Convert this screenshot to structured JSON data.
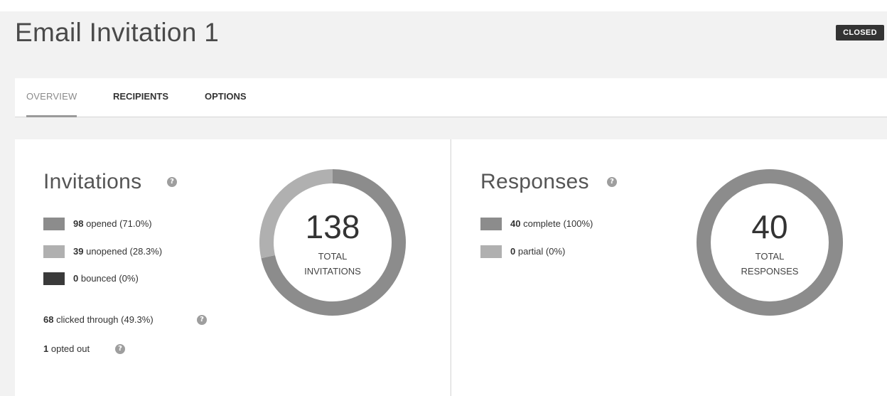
{
  "header": {
    "title": "Email Invitation 1",
    "status": "CLOSED"
  },
  "tabs": [
    {
      "label": "OVERVIEW",
      "active": true
    },
    {
      "label": "RECIPIENTS",
      "active": false
    },
    {
      "label": "OPTIONS",
      "active": false
    }
  ],
  "invitations": {
    "title": "Invitations",
    "legend": [
      {
        "count": "98",
        "text": "opened (71.0%)",
        "color": "#8c8c8c"
      },
      {
        "count": "39",
        "text": "unopened (28.3%)",
        "color": "#b0b0b0"
      },
      {
        "count": "0",
        "text": "bounced (0%)",
        "color": "#3a3a3a"
      }
    ],
    "clicked": {
      "count": "68",
      "text": "clicked through (49.3%)"
    },
    "opted_out": {
      "count": "1",
      "text": "opted out"
    },
    "total": "138",
    "total_label_1": "TOTAL",
    "total_label_2": "INVITATIONS",
    "segments": [
      {
        "name": "opened",
        "value": 98,
        "color": "#8c8c8c"
      },
      {
        "name": "unopened",
        "value": 39,
        "color": "#b0b0b0"
      },
      {
        "name": "bounced",
        "value": 0,
        "color": "#3a3a3a"
      }
    ]
  },
  "responses": {
    "title": "Responses",
    "legend": [
      {
        "count": "40",
        "text": "complete (100%)",
        "color": "#8c8c8c"
      },
      {
        "count": "0",
        "text": "partial (0%)",
        "color": "#b0b0b0"
      }
    ],
    "total": "40",
    "total_label_1": "TOTAL",
    "total_label_2": "RESPONSES",
    "segments": [
      {
        "name": "complete",
        "value": 40,
        "color": "#8c8c8c"
      },
      {
        "name": "partial",
        "value": 0,
        "color": "#b0b0b0"
      }
    ]
  }
}
